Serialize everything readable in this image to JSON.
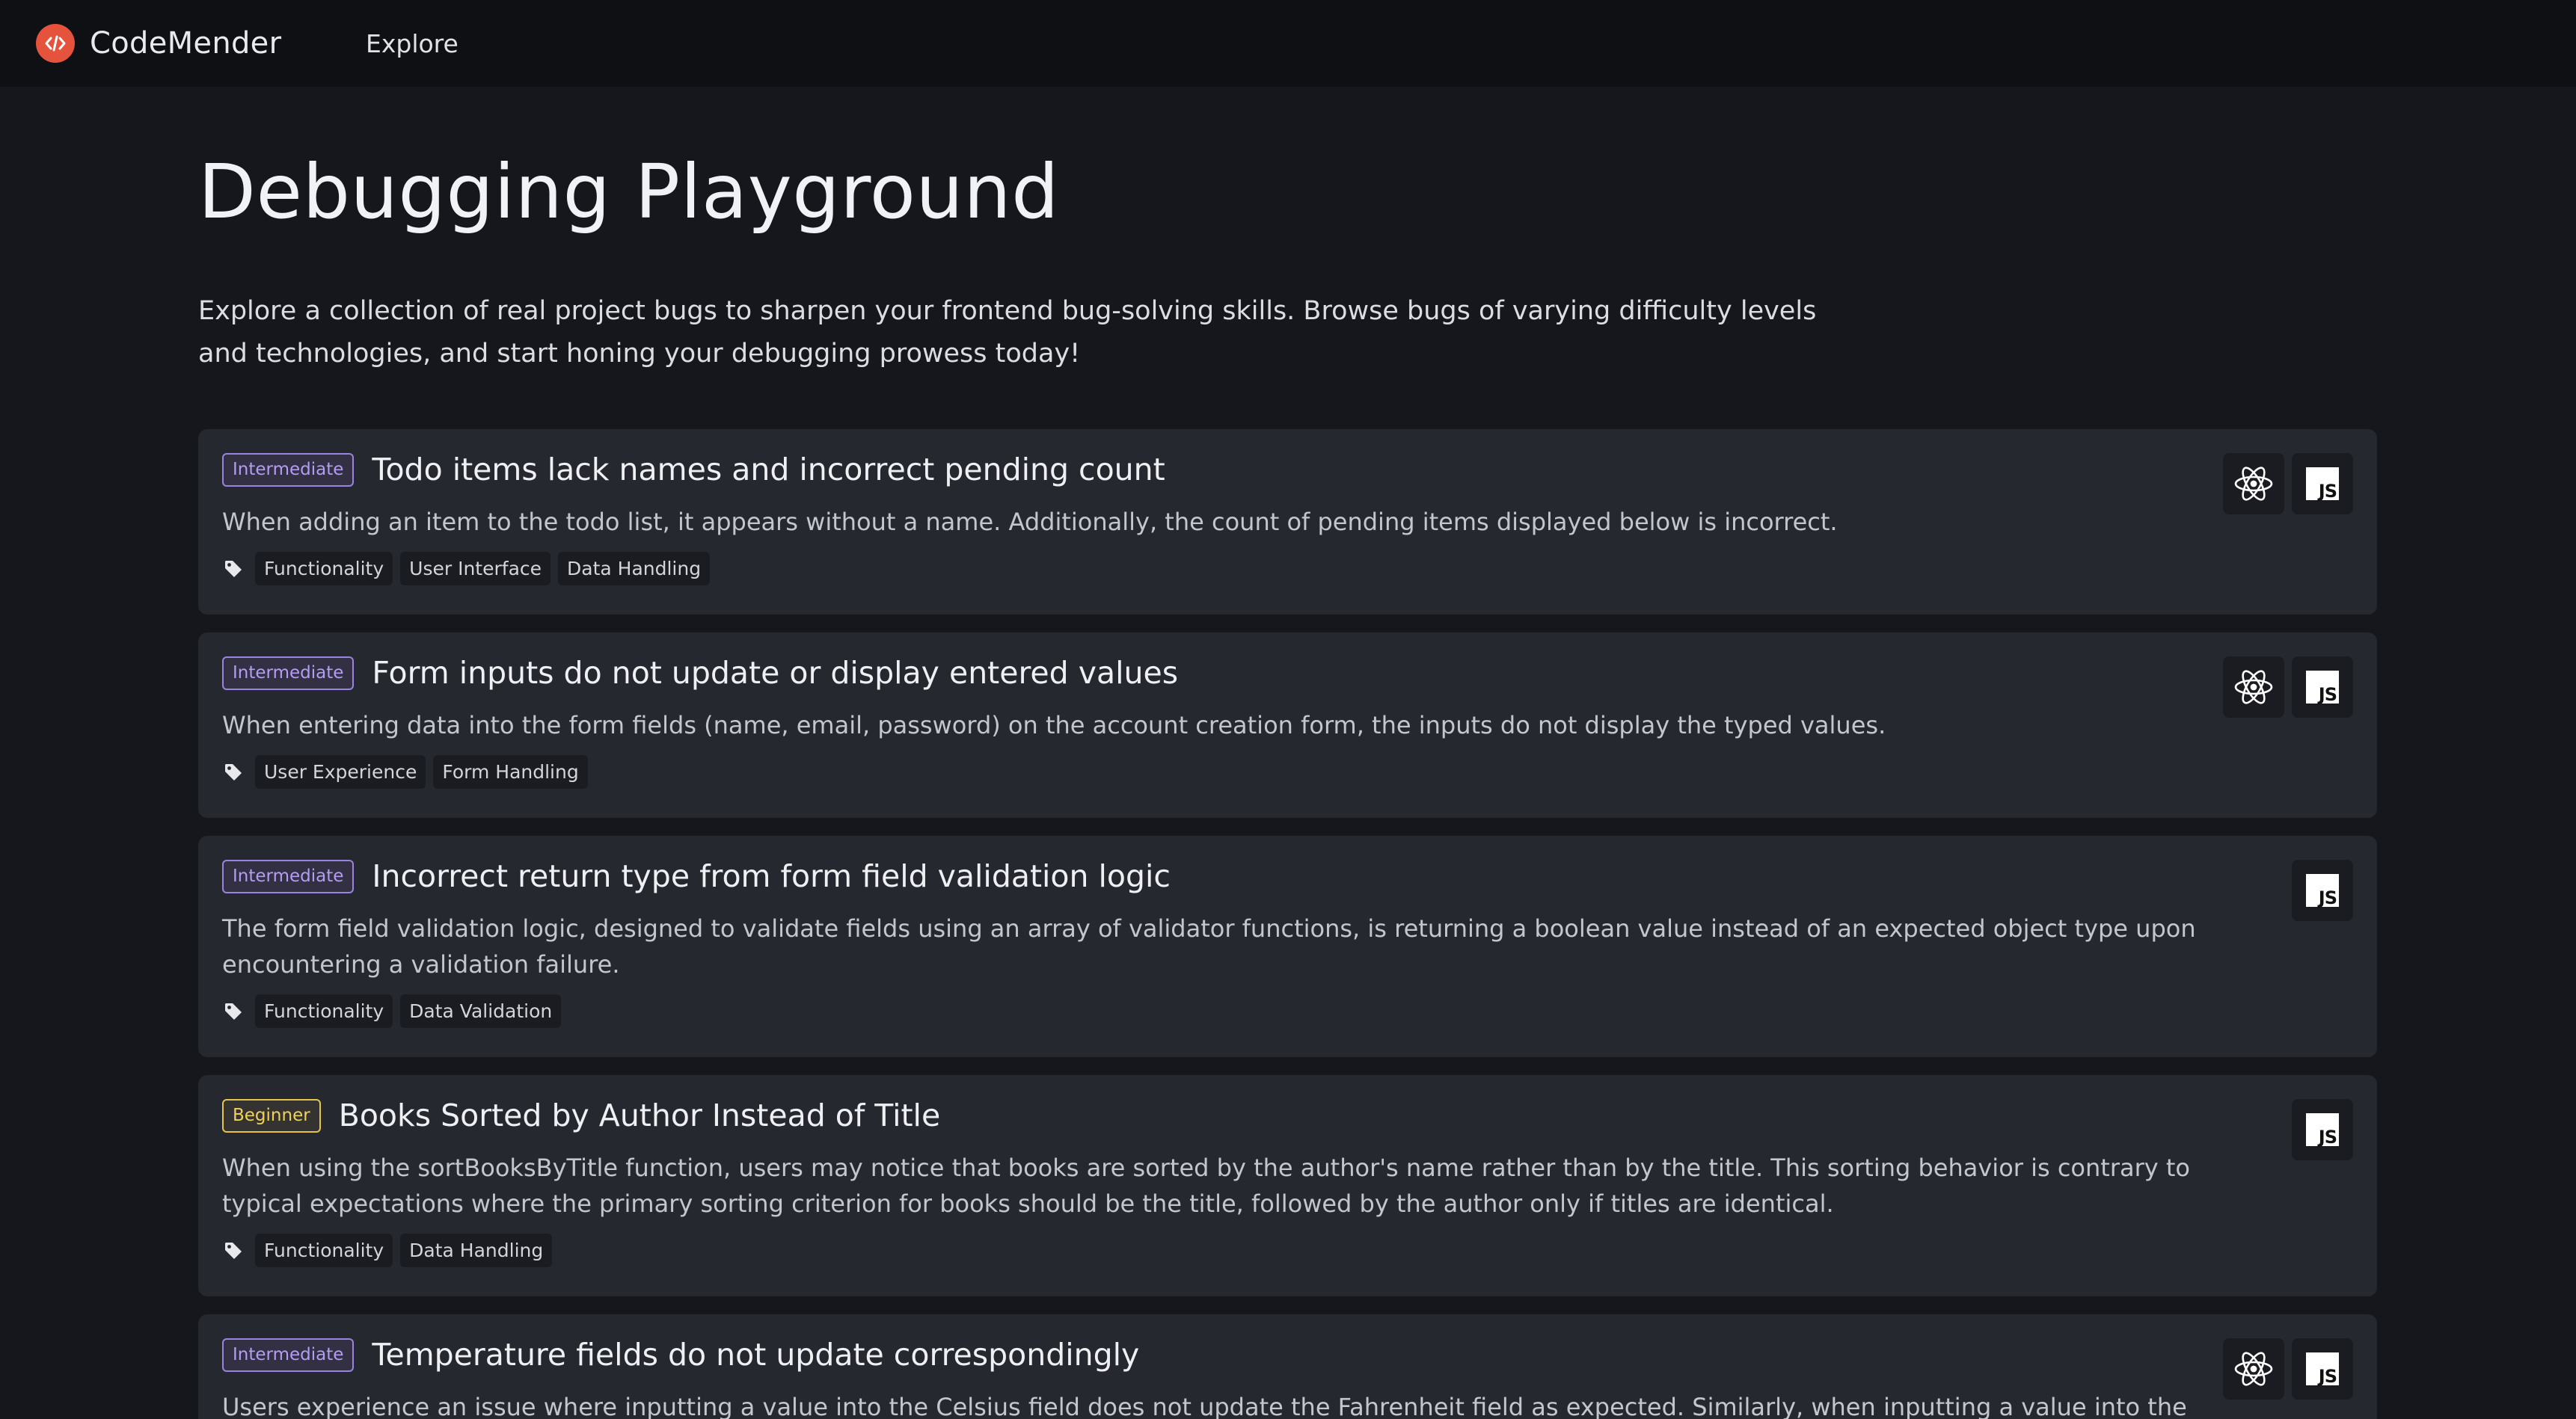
{
  "app": {
    "name": "CodeMender",
    "nav_explore": "Explore"
  },
  "page": {
    "title": "Debugging Playground",
    "intro": "Explore a collection of real project bugs to sharpen your frontend bug-solving skills. Browse bugs of varying difficulty levels and technologies, and start honing your debugging prowess today!"
  },
  "bugs": [
    {
      "level": "Intermediate",
      "title": "Todo items lack names and incorrect pending count",
      "description": "When adding an item to the todo list, it appears without a name. Additionally, the count of pending items displayed below is incorrect.",
      "tags": [
        "Functionality",
        "User Interface",
        "Data Handling"
      ],
      "tech": [
        "react-icon",
        "javascript-icon"
      ]
    },
    {
      "level": "Intermediate",
      "title": "Form inputs do not update or display entered values",
      "description": "When entering data into the form fields (name, email, password) on the account creation form, the inputs do not display the typed values.",
      "tags": [
        "User Experience",
        "Form Handling"
      ],
      "tech": [
        "react-icon",
        "javascript-icon"
      ]
    },
    {
      "level": "Intermediate",
      "title": "Incorrect return type from form field validation logic",
      "description": "The form field validation logic, designed to validate fields using an array of validator functions, is returning a boolean value instead of an expected object type upon encountering a validation failure.",
      "tags": [
        "Functionality",
        "Data Validation"
      ],
      "tech": [
        "javascript-icon"
      ]
    },
    {
      "level": "Beginner",
      "title": "Books Sorted by Author Instead of Title",
      "description": "When using the sortBooksByTitle function, users may notice that books are sorted by the author's name rather than by the title. This sorting behavior is contrary to typical expectations where the primary sorting criterion for books should be the title, followed by the author only if titles are identical.",
      "tags": [
        "Functionality",
        "Data Handling"
      ],
      "tech": [
        "javascript-icon"
      ]
    },
    {
      "level": "Intermediate",
      "title": "Temperature fields do not update correspondingly",
      "description": "Users experience an issue where inputting a value into the Celsius field does not update the Fahrenheit field as expected. Similarly, when inputting a value into the",
      "tags": [],
      "tech": [
        "react-icon",
        "javascript-icon"
      ]
    }
  ],
  "colors": {
    "brand": "#e5533d",
    "intermediate": "#9b83e0",
    "beginner": "#e3c547"
  }
}
